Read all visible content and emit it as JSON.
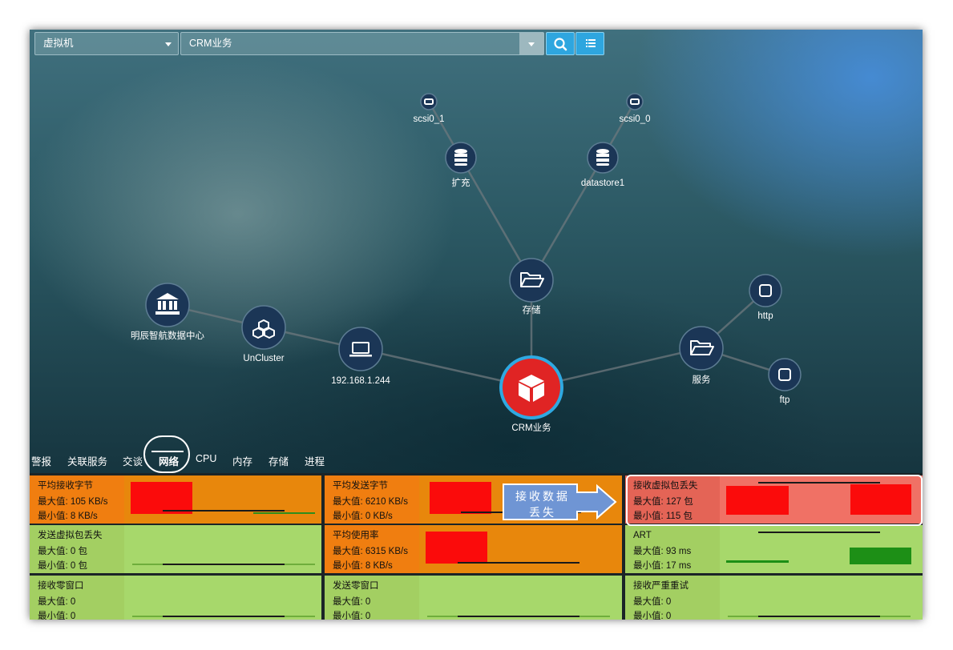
{
  "search": {
    "type_value": "虚拟机",
    "target_value": "CRM业务"
  },
  "icons": {
    "search": "search-icon",
    "list": "list-icon"
  },
  "nodes": {
    "scsi0_1": "scsi0_1",
    "scsi0_0": "scsi0_0",
    "kuochong": "扩充",
    "datastore1": "datastore1",
    "storage": "存储",
    "http": "http",
    "ftp": "ftp",
    "service": "服务",
    "datacenter": "明辰智航数据中心",
    "uncluster": "UnCluster",
    "ip": "192.168.1.244",
    "crm": "CRM业务"
  },
  "tabs": [
    "警报",
    "关联服务",
    "交谈",
    "网络",
    "CPU",
    "内存",
    "存储",
    "进程"
  ],
  "active_tab": "网络",
  "metrics": [
    {
      "title": "平均接收字节",
      "max": "最大值: 105 KB/s",
      "min": "最小值: 8 KB/s",
      "status": "orange"
    },
    {
      "title": "平均发送字节",
      "max": "最大值: 6210 KB/s",
      "min": "最小值: 0 KB/s",
      "status": "orange"
    },
    {
      "title": "接收虚拟包丢失",
      "max": "最大值: 127 包",
      "min": "最小值: 115 包",
      "status": "red"
    },
    {
      "title": "发送虚拟包丢失",
      "max": "最大值: 0 包",
      "min": "最小值: 0 包",
      "status": "green"
    },
    {
      "title": "平均使用率",
      "max": "最大值: 6315 KB/s",
      "min": "最小值: 8 KB/s",
      "status": "orange"
    },
    {
      "title": "ART",
      "max": "最大值: 93 ms",
      "min": "最小值: 17 ms",
      "status": "green"
    },
    {
      "title": "接收零窗口",
      "max": "最大值: 0",
      "min": "最小值: 0",
      "status": "green"
    },
    {
      "title": "发送零窗口",
      "max": "最大值: 0",
      "min": "最小值: 0",
      "status": "green"
    },
    {
      "title": "接收严重重试",
      "max": "最大值: 0",
      "min": "最小值: 0",
      "status": "green"
    }
  ],
  "callout": {
    "line1": "接收数据",
    "line2": "丢失"
  },
  "colors": {
    "orange": "#f07e10",
    "green": "#a3cf62",
    "red": "#e46456",
    "accent": "#2ea6df",
    "alert_node": "#e02424"
  }
}
